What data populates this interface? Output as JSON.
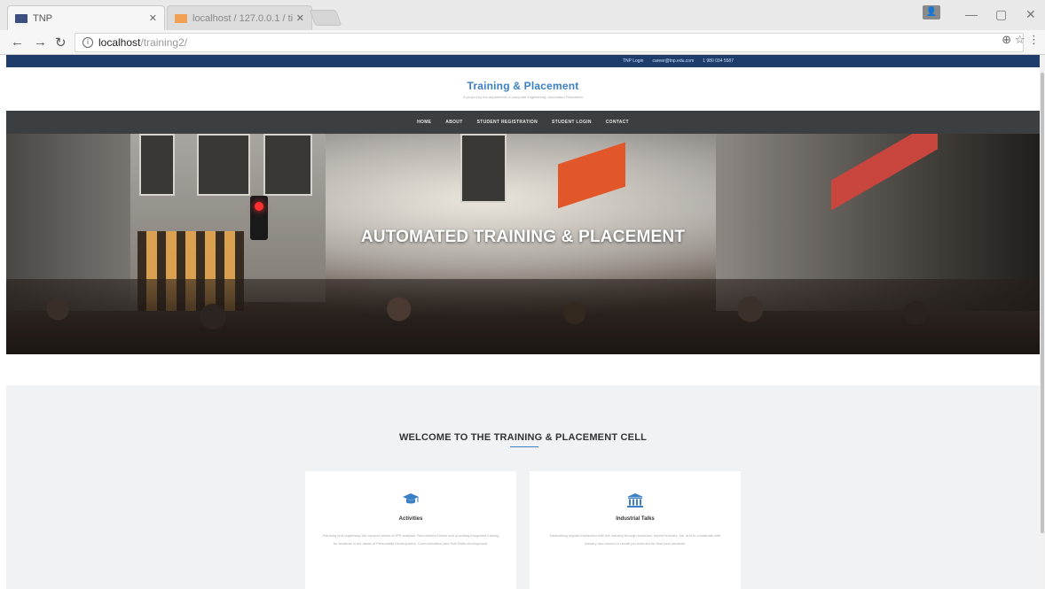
{
  "browser": {
    "tabs": [
      {
        "title": "TNP",
        "active": true
      },
      {
        "title": "localhost / 127.0.0.1 / ti",
        "active": false
      }
    ],
    "address": {
      "host": "localhost",
      "path": "/training2/"
    },
    "window_controls": [
      "minimize",
      "restore",
      "close"
    ]
  },
  "topbar": {
    "items": [
      "TNP Login",
      "career@tnp.edu.com",
      "1 980 034 5587"
    ]
  },
  "brand": {
    "title": "Training & Placement",
    "subtitle": "A project by the department of computer engineering, Automated Placement"
  },
  "nav": {
    "items": [
      "HOME",
      "ABOUT",
      "STUDENT REGISTRATION",
      "STUDENT LOGIN",
      "CONTACT"
    ]
  },
  "hero": {
    "title": "AUTOMATED TRAINING & PLACEMENT"
  },
  "welcome": {
    "title": "WELCOME TO THE TRAINING & PLACEMENT CELL"
  },
  "cards": [
    {
      "icon": "graduation-cap-icon",
      "title": "Activities",
      "description": "Planning and organising the campus drives of IPR analysis, Recruitment Drives and providing integrated training for students in the areas of Personality Development, Communication and Soft Skills development."
    },
    {
      "icon": "institution-icon",
      "title": "Industrial Talks",
      "description": "Networking regular interaction with the industry through seminars, expert lectures, etc. and to coordinate with industry and alumni to create job avenues for final year students."
    }
  ],
  "colors": {
    "topbar": "#1f3d6b",
    "brand_blue": "#3b7fc4",
    "navbar": "#3c3f41",
    "section_bg": "#f1f2f4"
  }
}
